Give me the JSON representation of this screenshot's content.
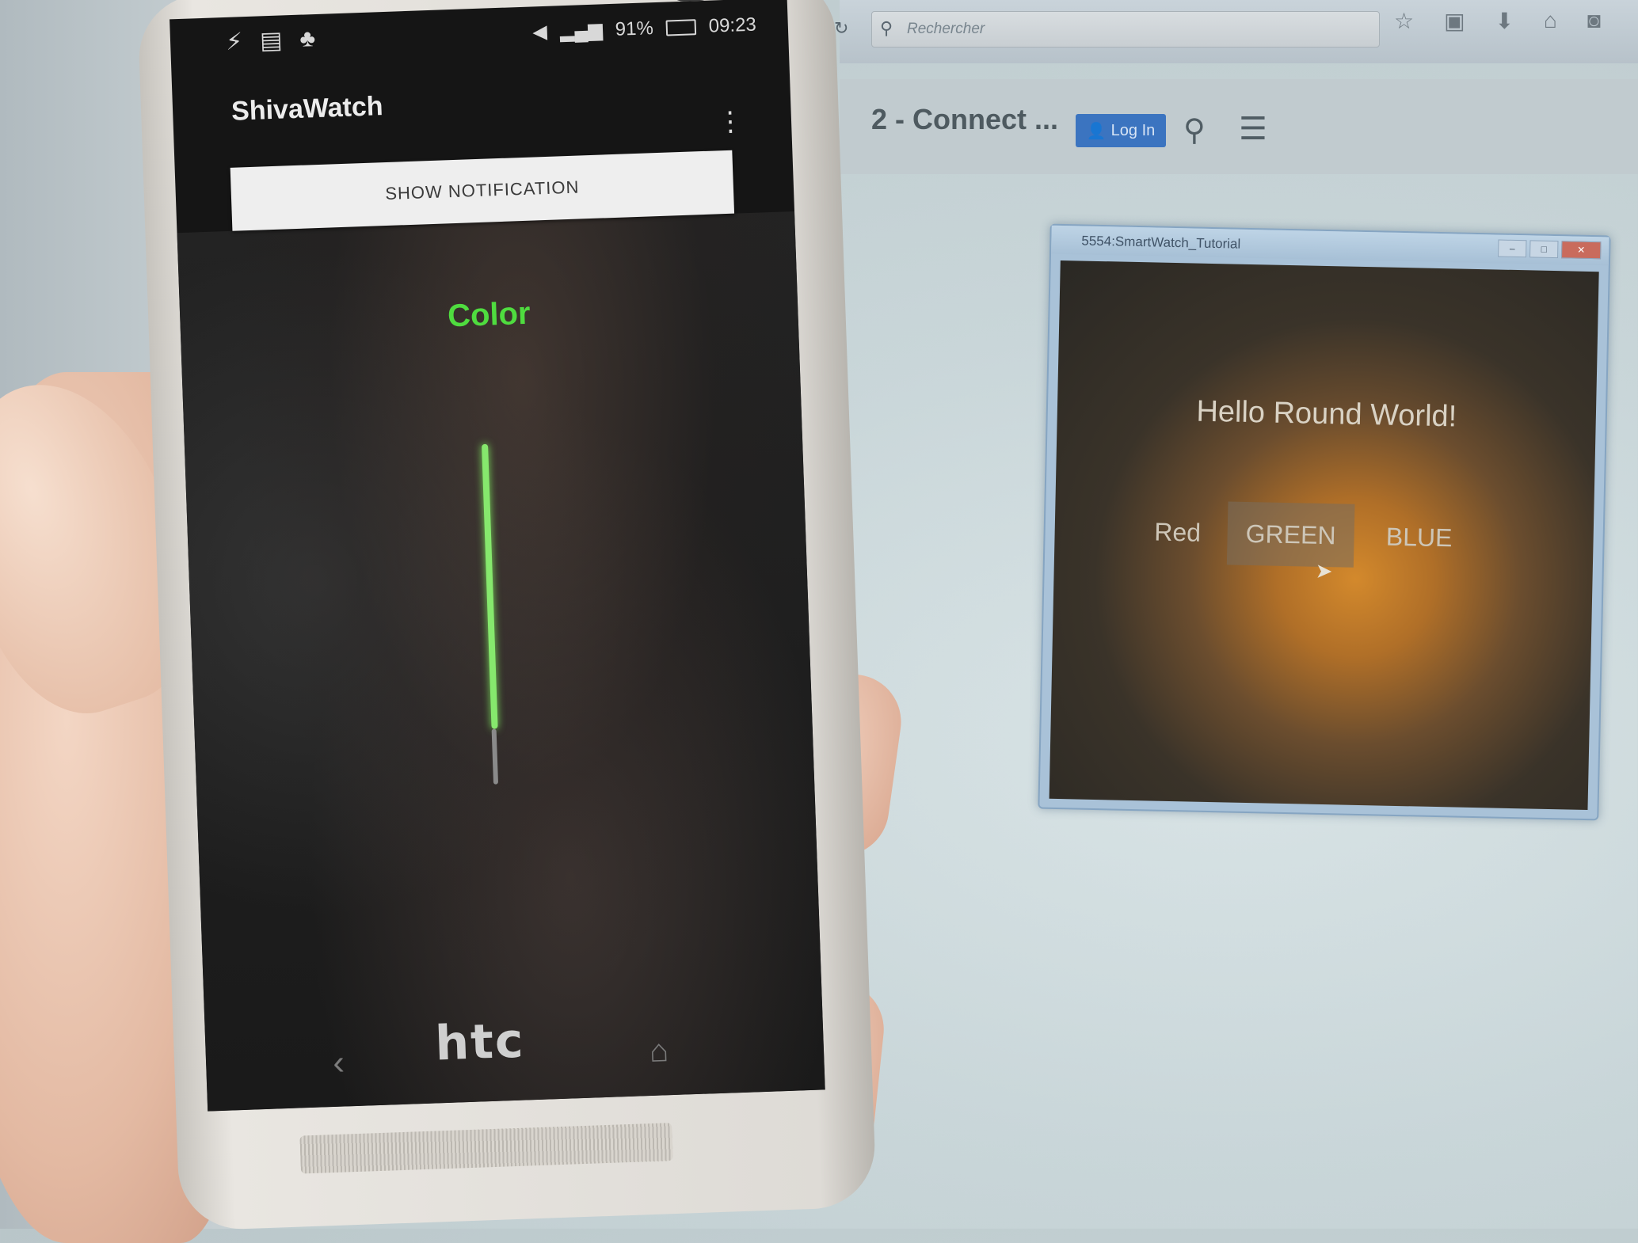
{
  "browser": {
    "search_placeholder": "Rechercher",
    "page_title": "2 - Connect ...",
    "login_label": "Log In",
    "colors": {
      "accent": "#3b74c0"
    }
  },
  "emulator": {
    "window_title": "5554:SmartWatch_Tutorial",
    "hello_text": "Hello Round World!",
    "buttons": {
      "red": "Red",
      "green": "GREEN",
      "blue": "BLUE"
    }
  },
  "phone": {
    "brand": "htc",
    "status": {
      "battery": "91%",
      "time": "09:23"
    },
    "app_title": "ShivaWatch",
    "show_notification_label": "SHOW NOTIFICATION",
    "color_label": "Color",
    "colors": {
      "color_label": "#4fdc3f",
      "seekbar": "#86e86d"
    }
  }
}
